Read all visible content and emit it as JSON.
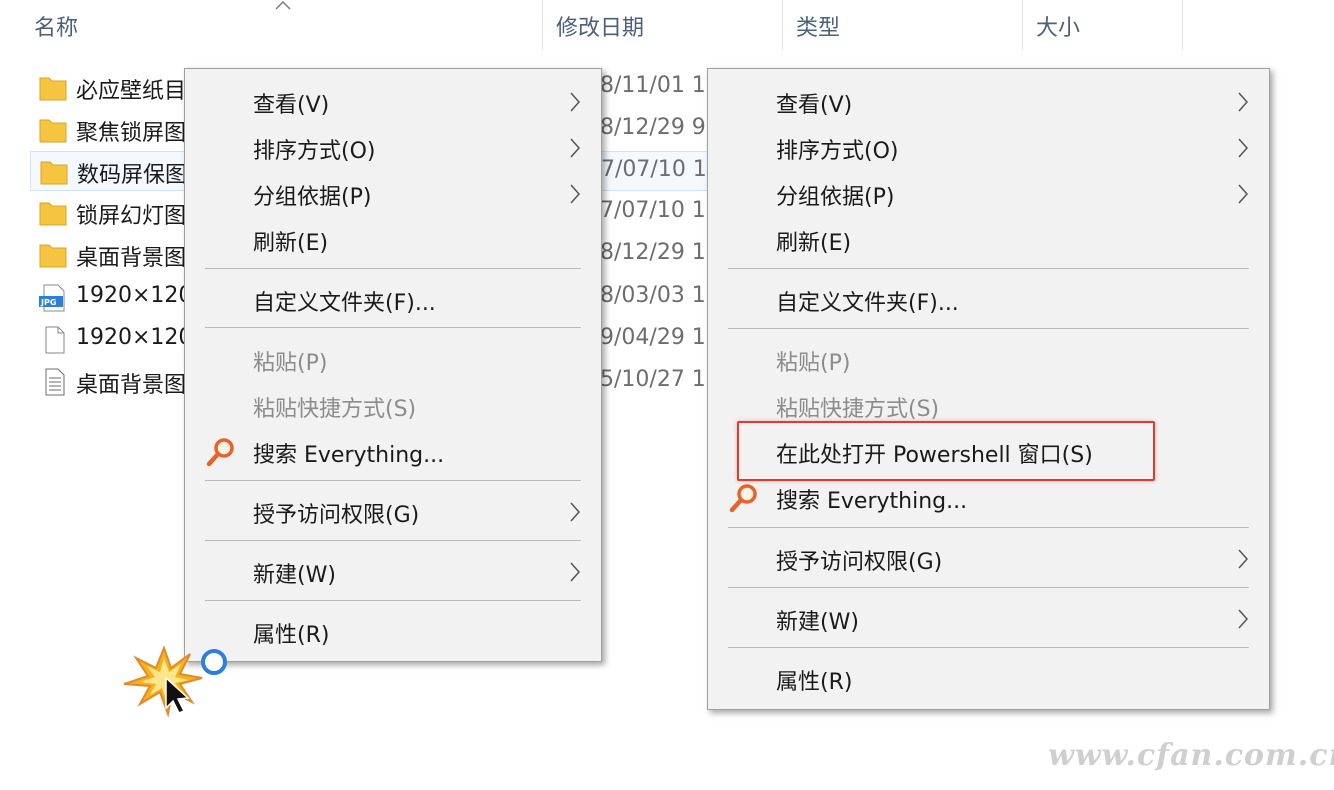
{
  "header": {
    "col_name": "名称",
    "col_modified": "修改日期",
    "col_type": "类型",
    "col_size": "大小"
  },
  "files": [
    {
      "name": "必应壁纸目",
      "date": "8/11/01 1",
      "icon": "folder-icon"
    },
    {
      "name": "聚焦锁屏图",
      "date": "8/12/29 9",
      "icon": "folder-icon"
    },
    {
      "name": "数码屏保图",
      "date": "7/07/10 1",
      "icon": "folder-icon",
      "selected": true
    },
    {
      "name": "锁屏幻灯图",
      "date": "7/07/10 1",
      "icon": "folder-icon"
    },
    {
      "name": "桌面背景图",
      "date": "8/12/29 1",
      "icon": "folder-icon"
    },
    {
      "name": "1920×120",
      "date": "8/03/03 1",
      "icon": "jpg-file-icon",
      "badge": "JPG"
    },
    {
      "name": "1920×120",
      "date": "9/04/29 1",
      "icon": "blank-file-icon"
    },
    {
      "name": "桌面背景图",
      "date": "5/10/27 1",
      "icon": "text-file-icon"
    }
  ],
  "menu_left": {
    "view": "查看(V)",
    "sort": "排序方式(O)",
    "group": "分组依据(P)",
    "refresh": "刷新(E)",
    "customize": "自定义文件夹(F)...",
    "paste": "粘贴(P)",
    "paste_shortcut": "粘贴快捷方式(S)",
    "search": "搜索 Everything...",
    "give_access": "授予访问权限(G)",
    "new": "新建(W)",
    "properties": "属性(R)"
  },
  "menu_right": {
    "view": "查看(V)",
    "sort": "排序方式(O)",
    "group": "分组依据(P)",
    "refresh": "刷新(E)",
    "customize": "自定义文件夹(F)...",
    "paste": "粘贴(P)",
    "paste_shortcut": "粘贴快捷方式(S)",
    "powershell": "在此处打开 Powershell 窗口(S)",
    "search": "搜索 Everything...",
    "give_access": "授予访问权限(G)",
    "new": "新建(W)",
    "properties": "属性(R)"
  },
  "watermark": "www.cfan.com.cn",
  "colors": {
    "folder": "#f5c542",
    "highlight": "#e03c2e",
    "search_icon": "#e8632b",
    "header_text": "#4c607a"
  }
}
